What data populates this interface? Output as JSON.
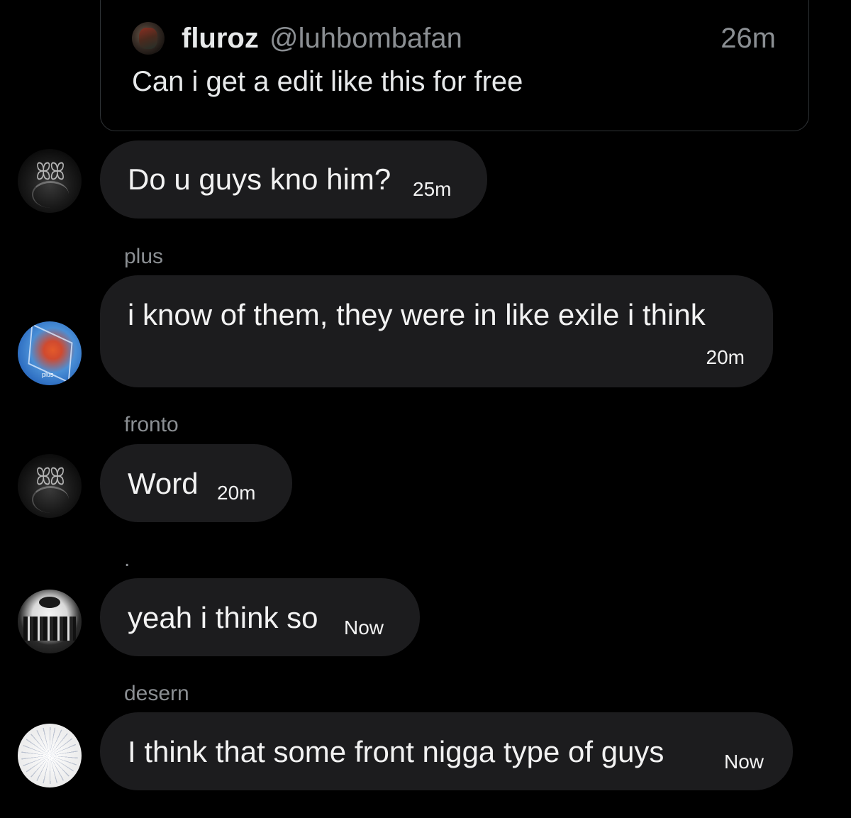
{
  "quoted_post": {
    "display_name": "fluroz",
    "handle": "@luhbombafan",
    "time": "26m",
    "text": "Can i get a edit like this for free",
    "avatar_icon": "profile-avatar"
  },
  "messages": [
    {
      "sender": "",
      "text": "Do u guys kno him?",
      "time": "25m",
      "avatar_icon": "gothic-logo-avatar"
    },
    {
      "sender": "plus",
      "text": "i know of them, they were in like exile i think",
      "time": "20m",
      "avatar_icon": "blue-star-avatar",
      "avatar_label": "plus"
    },
    {
      "sender": "fronto",
      "text": "Word",
      "time": "20m",
      "avatar_icon": "gothic-logo-avatar"
    },
    {
      "sender": ".",
      "text": "yeah i think so",
      "time": "Now",
      "avatar_icon": "band-photo-avatar"
    },
    {
      "sender": "desern",
      "text": "I think that some front nigga type of guys",
      "time": "Now",
      "avatar_icon": "white-burst-avatar"
    }
  ],
  "colors": {
    "background": "#000000",
    "bubble": "#1c1c1e",
    "secondary_text": "#8b8f93",
    "primary_text": "#e7e9ea"
  }
}
